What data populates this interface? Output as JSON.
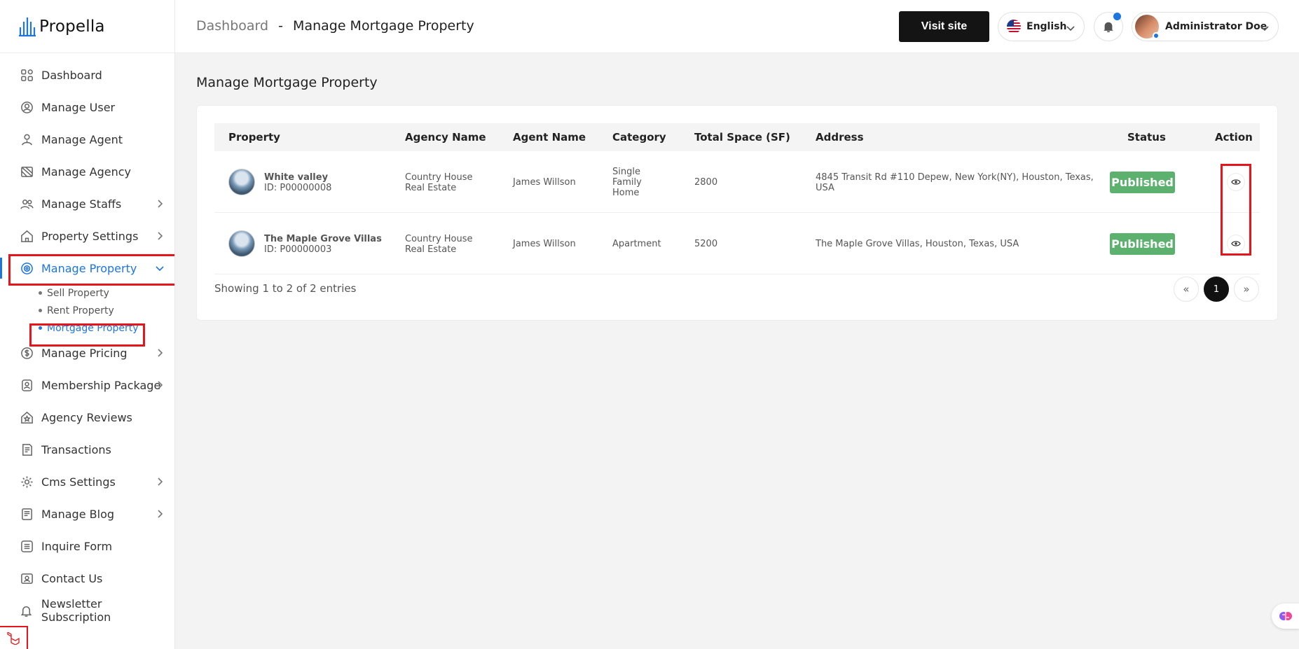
{
  "brand": {
    "name": "Propella"
  },
  "sidebar": {
    "items": [
      {
        "label": "Dashboard",
        "icon": "grid-icon"
      },
      {
        "label": "Manage User",
        "icon": "user-circle-icon"
      },
      {
        "label": "Manage Agent",
        "icon": "agent-icon"
      },
      {
        "label": "Manage Agency",
        "icon": "agency-icon"
      },
      {
        "label": "Manage Staffs",
        "icon": "users-icon"
      },
      {
        "label": "Property Settings",
        "icon": "home-icon"
      },
      {
        "label": "Manage Property",
        "icon": "property-gear-icon"
      },
      {
        "label": "Manage Pricing",
        "icon": "dollar-icon"
      },
      {
        "label": "Membership Package",
        "icon": "membership-icon"
      },
      {
        "label": "Agency Reviews",
        "icon": "star-icon"
      },
      {
        "label": "Transactions",
        "icon": "transaction-icon"
      },
      {
        "label": "Cms Settings",
        "icon": "gear-icon"
      },
      {
        "label": "Manage Blog",
        "icon": "blog-icon"
      },
      {
        "label": "Inquire Form",
        "icon": "form-icon"
      },
      {
        "label": "Contact Us",
        "icon": "contact-icon"
      },
      {
        "label": "Newsletter Subscription",
        "icon": "bell-icon"
      }
    ],
    "submenu": [
      {
        "label": "Sell Property"
      },
      {
        "label": "Rent Property"
      },
      {
        "label": "Mortgage Property"
      }
    ]
  },
  "header": {
    "breadcrumb_home": "Dashboard",
    "breadcrumb_sep": "-",
    "breadcrumb_current": "Manage Mortgage Property",
    "visit_site": "Visit site",
    "language": "English",
    "user_name": "Administrator Doe"
  },
  "page": {
    "title": "Manage Mortgage Property"
  },
  "table": {
    "headers": [
      "Property",
      "Agency Name",
      "Agent Name",
      "Category",
      "Total Space (SF)",
      "Address",
      "Status",
      "Action"
    ],
    "rows": [
      {
        "name": "White valley",
        "id": "ID: P00000008",
        "agency_l1": "Country House",
        "agency_l2": "Real Estate",
        "agent": "James Willson",
        "cat_l1": "Single",
        "cat_l2": "Family",
        "cat_l3": "Home",
        "space": "2800",
        "addr_l1": "4845 Transit Rd #110 Depew, New York(NY), Houston, Texas,",
        "addr_l2": "USA",
        "status": "Published"
      },
      {
        "name": "The Maple Grove Villas",
        "id": "ID: P00000003",
        "agency_l1": "Country House",
        "agency_l2": "Real Estate",
        "agent": "James Willson",
        "cat_l1": "Apartment",
        "space": "5200",
        "addr_l1": "The Maple Grove Villas, Houston, Texas, USA",
        "status": "Published"
      }
    ],
    "footer": "Showing 1 to 2 of 2 entries",
    "pagination": {
      "prev": "«",
      "current": "1",
      "next": "»"
    }
  },
  "colors": {
    "accent": "#1d75e0",
    "published": "#5cb16f",
    "highlight": "#e5161b"
  }
}
